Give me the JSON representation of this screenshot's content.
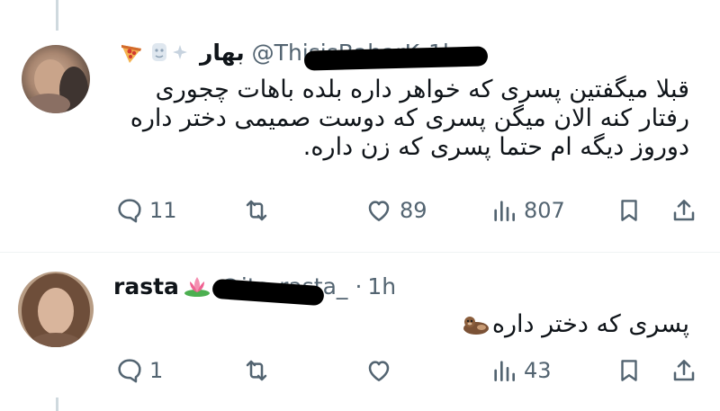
{
  "tweets": [
    {
      "display_name": "بهار",
      "handle": "@ThisisBaharK",
      "time": "1h",
      "text_lines": [
        "قبلا میگفتین پسری که خواهر داره بلده باهات چجوری",
        "رفتار کنه الان میگن پسری که دوست صمیمی دختر داره",
        "دوروز دیگه ام حتما پسری که زن داره."
      ],
      "replies": "11",
      "retweets": "",
      "likes": "89",
      "views": "807",
      "name_emojis": [
        "pizza-emoji",
        "face-emoji",
        "sparkle-emoji"
      ]
    },
    {
      "display_name": "rasta",
      "handle": "@its_rasta_",
      "separator": "·",
      "time": "1h",
      "text_lines": [
        "پسری که دختر داره"
      ],
      "replies": "1",
      "retweets": "",
      "likes": "",
      "views": "43",
      "name_emojis": [
        "lotus-emoji"
      ],
      "text_emojis": [
        "otter-emoji"
      ]
    }
  ],
  "icons": {
    "reply": "speech-bubble-icon",
    "retweet": "retweet-arrows-icon",
    "like": "heart-icon",
    "views": "bar-chart-icon",
    "bookmark": "bookmark-icon",
    "share": "share-upload-icon"
  },
  "colors": {
    "text": "#0f1419",
    "secondary": "#536471",
    "thread_line": "#cfd9de",
    "redaction": "#000000"
  }
}
